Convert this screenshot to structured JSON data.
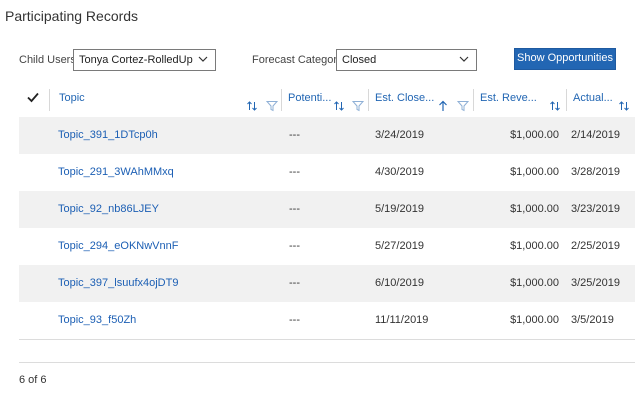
{
  "page": {
    "title": "Participating Records"
  },
  "filters": {
    "child_users_label": "Child Users",
    "child_users_value": "Tonya Cortez-RolledUp",
    "forecast_category_label": "Forecast Category",
    "forecast_category_value": "Closed",
    "show_button_label": "Show Opportunities"
  },
  "columns": [
    {
      "label": "Topic",
      "icons": [
        "sort-icon",
        "filter-icon"
      ]
    },
    {
      "label": "Potenti...",
      "icons": [
        "sort-icon",
        "filter-icon"
      ]
    },
    {
      "label": "Est. Close...",
      "icons": [
        "sort-ascending-icon",
        "filter-icon"
      ]
    },
    {
      "label": "Est. Reve...",
      "icons": [
        "sort-icon"
      ]
    },
    {
      "label": "Actual...",
      "icons": [
        "sort-icon"
      ]
    }
  ],
  "rows": [
    {
      "topic": "Topic_391_1DTcp0h",
      "potential": "---",
      "est_close": "3/24/2019",
      "est_revenue": "$1,000.00",
      "actual": "2/14/2019"
    },
    {
      "topic": "Topic_291_3WAhMMxq",
      "potential": "---",
      "est_close": "4/30/2019",
      "est_revenue": "$1,000.00",
      "actual": "3/28/2019"
    },
    {
      "topic": "Topic_92_nb86LJEY",
      "potential": "---",
      "est_close": "5/19/2019",
      "est_revenue": "$1,000.00",
      "actual": "3/23/2019"
    },
    {
      "topic": "Topic_294_eOKNwVnnF",
      "potential": "---",
      "est_close": "5/27/2019",
      "est_revenue": "$1,000.00",
      "actual": "2/25/2019"
    },
    {
      "topic": "Topic_397_lsuufx4ojDT9",
      "potential": "---",
      "est_close": "6/10/2019",
      "est_revenue": "$1,000.00",
      "actual": "3/25/2019"
    },
    {
      "topic": "Topic_93_f50Zh",
      "potential": "---",
      "est_close": "11/11/2019",
      "est_revenue": "$1,000.00",
      "actual": "3/5/2019"
    }
  ],
  "footer": {
    "record_count": "6 of 6"
  },
  "colors": {
    "accent": "#2266b3",
    "link": "#1c5fb4",
    "row_shade": "#f1f1f1"
  }
}
